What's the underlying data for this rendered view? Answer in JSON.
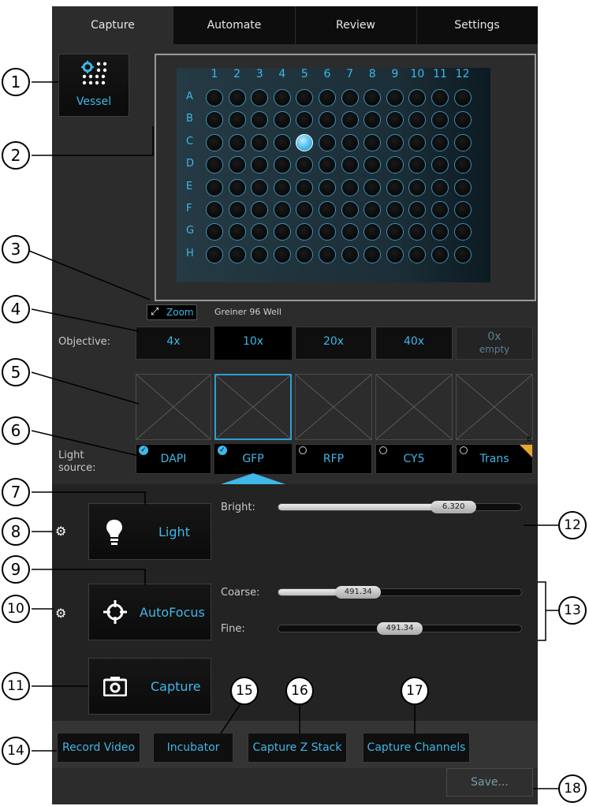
{
  "tabs": [
    {
      "label": "Capture",
      "active": true
    },
    {
      "label": "Automate",
      "active": false
    },
    {
      "label": "Review",
      "active": false
    },
    {
      "label": "Settings",
      "active": false
    }
  ],
  "vessel": {
    "label": "Vessel"
  },
  "plate": {
    "columns": [
      "1",
      "2",
      "3",
      "4",
      "5",
      "6",
      "7",
      "8",
      "9",
      "10",
      "11",
      "12"
    ],
    "rows": [
      "A",
      "B",
      "C",
      "D",
      "E",
      "F",
      "G",
      "H"
    ],
    "selected_well": "C5",
    "name": "Greiner 96 Well"
  },
  "zoom": {
    "label": "Zoom"
  },
  "objective": {
    "label": "Objective:",
    "options": [
      {
        "label": "4x",
        "sub": ""
      },
      {
        "label": "10x",
        "sub": ""
      },
      {
        "label": "20x",
        "sub": ""
      },
      {
        "label": "40x",
        "sub": ""
      },
      {
        "label": "0x",
        "sub": "empty"
      }
    ],
    "selected": "10x"
  },
  "light_source": {
    "label_line1": "Light",
    "label_line2": "source:",
    "options": [
      {
        "label": "DAPI",
        "checked": true
      },
      {
        "label": "GFP",
        "checked": true
      },
      {
        "label": "RFP",
        "checked": false
      },
      {
        "label": "CY5",
        "checked": false
      },
      {
        "label": "Trans",
        "checked": false,
        "badge": "B"
      }
    ],
    "selected": "GFP"
  },
  "controls": {
    "light_label": "Light",
    "autofocus_label": "AutoFocus",
    "capture_label": "Capture",
    "bright": {
      "label": "Bright:",
      "value": "6.320",
      "fraction": 0.72
    },
    "coarse": {
      "label": "Coarse:",
      "value": "491.34",
      "fraction": 0.33
    },
    "fine": {
      "label": "Fine:",
      "value": "491.34",
      "fraction": 0.5
    }
  },
  "bottom_buttons": {
    "record_video": "Record Video",
    "incubator": "Incubator",
    "capture_z_stack": "Capture Z Stack",
    "capture_channels": "Capture Channels",
    "save": "Save..."
  },
  "callouts": [
    "1",
    "2",
    "3",
    "4",
    "5",
    "6",
    "7",
    "8",
    "9",
    "10",
    "11",
    "12",
    "13",
    "14",
    "15",
    "16",
    "17",
    "18"
  ],
  "colors": {
    "accent": "#3fb7e8",
    "panel": "#2c2c2c",
    "dark": "#0d0d0d"
  }
}
